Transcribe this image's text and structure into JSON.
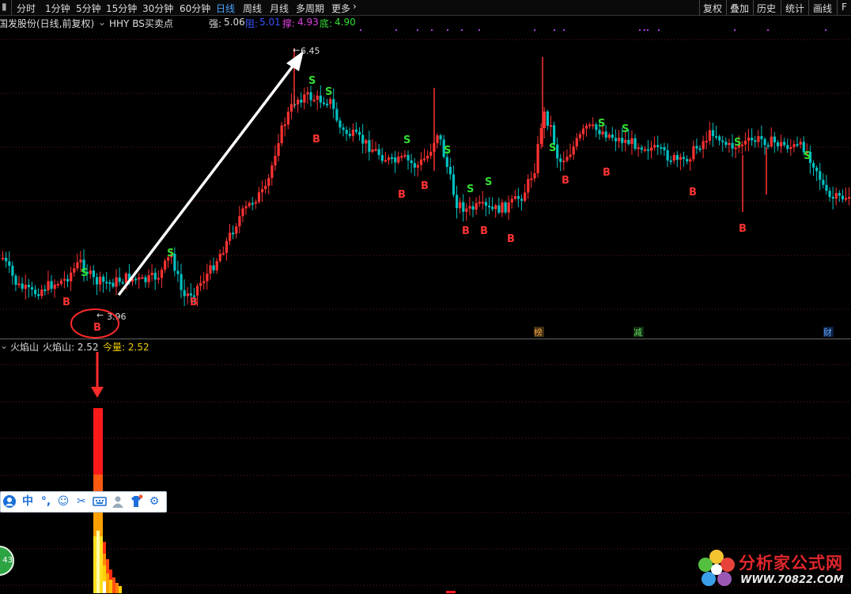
{
  "toolbar": {
    "tabs": [
      "分时",
      "1分钟",
      "5分钟",
      "15分钟",
      "30分钟",
      "60分钟",
      "日线",
      "周线",
      "月线",
      "多周期",
      "更多"
    ],
    "active_tab": "日线",
    "right_buttons": [
      "复权",
      "叠加",
      "历史",
      "统计",
      "画线",
      "F"
    ]
  },
  "infoline": {
    "title": "国发股份(日线,前复权)",
    "indicator": "HHY BS买卖点",
    "strong_label": "强:",
    "strong_value": "5.06",
    "resist_label": "阻:",
    "resist_value": "5.01",
    "support_label": "撑:",
    "support_value": "4.93",
    "bottom_label": "底:",
    "bottom_value": "4.90"
  },
  "main_chart": {
    "high_label": "6.45",
    "low_label": "3.96",
    "signal_circle_text": "B",
    "event_markers": [
      "榜",
      "减",
      "财"
    ],
    "signals": {
      "buy_label": "B",
      "sell_label": "S"
    },
    "colors": {
      "up": "#ff3232",
      "down": "#00c0c0",
      "buy": "#ff3232",
      "sell": "#33dd33",
      "arrow": "#ffffff",
      "grid": "#6a1c1c"
    }
  },
  "volume_panel": {
    "name": "火焰山",
    "line1": "火焰山: 2.52",
    "line2": "今量: 2.52"
  },
  "ime_bar": {
    "icons": [
      "user-icon",
      "chinese-mode-icon",
      "punctuation-icon",
      "emoji-icon",
      "scissors-icon",
      "keyboard-icon",
      "person-icon",
      "skin-icon",
      "settings-icon"
    ],
    "chinese_label": "中"
  },
  "left_badge": {
    "text": "43"
  },
  "watermark": {
    "title": "分析家公式网",
    "url": "WWW.70822.COM"
  }
}
